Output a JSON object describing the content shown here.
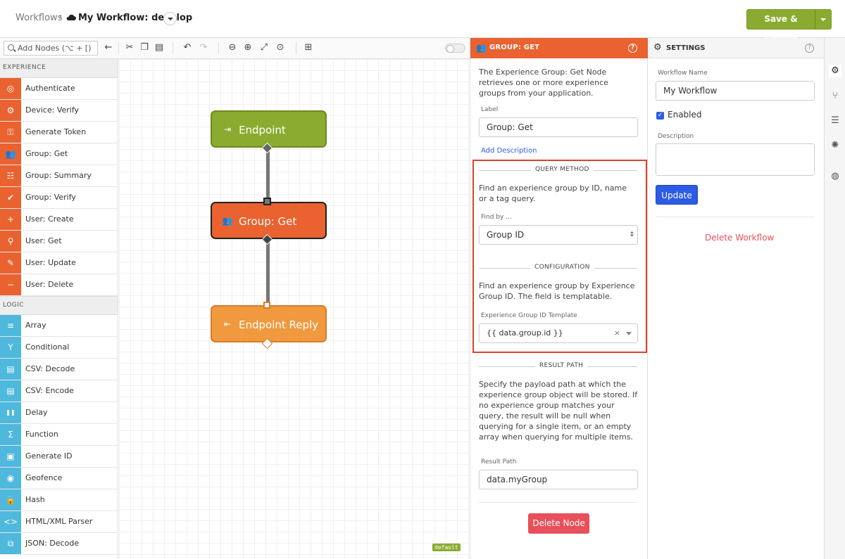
{
  "header": {
    "breadcrumb_root": "Workflows",
    "breadcrumb_sep": "›",
    "workflow_title": "My Workflow: develop",
    "save_deploy": "Save & Deploy"
  },
  "toolbar": {
    "search_placeholder": "Add Nodes (⌥ + [)"
  },
  "palette": {
    "sections": [
      {
        "title": "EXPERIENCE",
        "color": "#e96230",
        "items": [
          {
            "label": "Authenticate",
            "icon": "fingerprint-icon"
          },
          {
            "label": "Device: Verify",
            "icon": "device-verify-icon"
          },
          {
            "label": "Generate Token",
            "icon": "key-icon"
          },
          {
            "label": "Group: Get",
            "icon": "group-icon"
          },
          {
            "label": "Group: Summary",
            "icon": "group-summary-icon"
          },
          {
            "label": "Group: Verify",
            "icon": "group-verify-icon"
          },
          {
            "label": "User: Create",
            "icon": "user-add-icon"
          },
          {
            "label": "User: Get",
            "icon": "user-search-icon"
          },
          {
            "label": "User: Update",
            "icon": "user-edit-icon"
          },
          {
            "label": "User: Delete",
            "icon": "user-remove-icon"
          }
        ]
      },
      {
        "title": "LOGIC",
        "color": "#4fb8dd",
        "items": [
          {
            "label": "Array",
            "icon": "list-icon"
          },
          {
            "label": "Conditional",
            "icon": "fork-icon"
          },
          {
            "label": "CSV: Decode",
            "icon": "document-icon"
          },
          {
            "label": "CSV: Encode",
            "icon": "document-icon"
          },
          {
            "label": "Delay",
            "icon": "pause-icon"
          },
          {
            "label": "Function",
            "icon": "sigma-icon"
          },
          {
            "label": "Generate ID",
            "icon": "id-card-icon"
          },
          {
            "label": "Geofence",
            "icon": "target-icon"
          },
          {
            "label": "Hash",
            "icon": "lock-icon"
          },
          {
            "label": "HTML/XML Parser",
            "icon": "code-icon"
          },
          {
            "label": "JSON: Decode",
            "icon": "json-icon"
          }
        ]
      }
    ]
  },
  "canvas": {
    "nodes": [
      {
        "label": "Endpoint",
        "icon": "endpoint-icon"
      },
      {
        "label": "Group: Get",
        "icon": "group-icon"
      },
      {
        "label": "Endpoint Reply",
        "icon": "endpoint-reply-icon"
      }
    ],
    "default_tag": "default"
  },
  "node_panel": {
    "title": "GROUP: GET",
    "description": "The Experience Group: Get Node retrieves one or more experience groups from your application.",
    "label_field": "Label",
    "label_value": "Group: Get",
    "add_description": "Add Description",
    "query_method_title": "QUERY METHOD",
    "query_method_text": "Find an experience group by ID, name or a tag query.",
    "find_by_label": "Find by ...",
    "find_by_value": "Group ID",
    "configuration_title": "CONFIGURATION",
    "configuration_text": "Find an experience group by Experience Group ID. The field is templatable.",
    "template_label": "Experience Group ID Template",
    "template_value": "{{ data.group.id }}",
    "result_path_title": "RESULT PATH",
    "result_path_text": "Specify the payload path at which the experience group object will be stored. If no experience group matches your query, the result will be null when querying for a single item, or an empty array when querying for multiple items.",
    "result_path_label": "Result Path",
    "result_path_value": "data.myGroup",
    "delete_node": "Delete Node"
  },
  "settings_panel": {
    "title": "SETTINGS",
    "workflow_name_label": "Workflow Name",
    "workflow_name_value": "My Workflow",
    "enabled_label": "Enabled",
    "enabled": true,
    "description_label": "Description",
    "update_button": "Update",
    "delete_workflow": "Delete Workflow"
  },
  "colors": {
    "accent_green": "#8aab2f",
    "accent_orange": "#e96230",
    "logic_blue": "#4fb8dd",
    "primary_blue": "#2d5be3",
    "danger_red": "#e8505b"
  }
}
